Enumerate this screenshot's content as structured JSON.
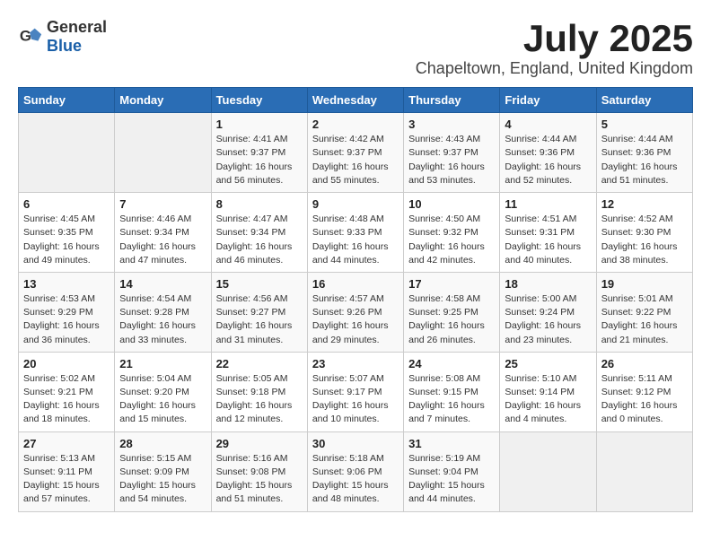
{
  "header": {
    "logo_general": "General",
    "logo_blue": "Blue",
    "month_title": "July 2025",
    "location": "Chapeltown, England, United Kingdom"
  },
  "days_of_week": [
    "Sunday",
    "Monday",
    "Tuesday",
    "Wednesday",
    "Thursday",
    "Friday",
    "Saturday"
  ],
  "weeks": [
    [
      {
        "day": "",
        "sunrise": "",
        "sunset": "",
        "daylight": ""
      },
      {
        "day": "",
        "sunrise": "",
        "sunset": "",
        "daylight": ""
      },
      {
        "day": "1",
        "sunrise": "Sunrise: 4:41 AM",
        "sunset": "Sunset: 9:37 PM",
        "daylight": "Daylight: 16 hours and 56 minutes."
      },
      {
        "day": "2",
        "sunrise": "Sunrise: 4:42 AM",
        "sunset": "Sunset: 9:37 PM",
        "daylight": "Daylight: 16 hours and 55 minutes."
      },
      {
        "day": "3",
        "sunrise": "Sunrise: 4:43 AM",
        "sunset": "Sunset: 9:37 PM",
        "daylight": "Daylight: 16 hours and 53 minutes."
      },
      {
        "day": "4",
        "sunrise": "Sunrise: 4:44 AM",
        "sunset": "Sunset: 9:36 PM",
        "daylight": "Daylight: 16 hours and 52 minutes."
      },
      {
        "day": "5",
        "sunrise": "Sunrise: 4:44 AM",
        "sunset": "Sunset: 9:36 PM",
        "daylight": "Daylight: 16 hours and 51 minutes."
      }
    ],
    [
      {
        "day": "6",
        "sunrise": "Sunrise: 4:45 AM",
        "sunset": "Sunset: 9:35 PM",
        "daylight": "Daylight: 16 hours and 49 minutes."
      },
      {
        "day": "7",
        "sunrise": "Sunrise: 4:46 AM",
        "sunset": "Sunset: 9:34 PM",
        "daylight": "Daylight: 16 hours and 47 minutes."
      },
      {
        "day": "8",
        "sunrise": "Sunrise: 4:47 AM",
        "sunset": "Sunset: 9:34 PM",
        "daylight": "Daylight: 16 hours and 46 minutes."
      },
      {
        "day": "9",
        "sunrise": "Sunrise: 4:48 AM",
        "sunset": "Sunset: 9:33 PM",
        "daylight": "Daylight: 16 hours and 44 minutes."
      },
      {
        "day": "10",
        "sunrise": "Sunrise: 4:50 AM",
        "sunset": "Sunset: 9:32 PM",
        "daylight": "Daylight: 16 hours and 42 minutes."
      },
      {
        "day": "11",
        "sunrise": "Sunrise: 4:51 AM",
        "sunset": "Sunset: 9:31 PM",
        "daylight": "Daylight: 16 hours and 40 minutes."
      },
      {
        "day": "12",
        "sunrise": "Sunrise: 4:52 AM",
        "sunset": "Sunset: 9:30 PM",
        "daylight": "Daylight: 16 hours and 38 minutes."
      }
    ],
    [
      {
        "day": "13",
        "sunrise": "Sunrise: 4:53 AM",
        "sunset": "Sunset: 9:29 PM",
        "daylight": "Daylight: 16 hours and 36 minutes."
      },
      {
        "day": "14",
        "sunrise": "Sunrise: 4:54 AM",
        "sunset": "Sunset: 9:28 PM",
        "daylight": "Daylight: 16 hours and 33 minutes."
      },
      {
        "day": "15",
        "sunrise": "Sunrise: 4:56 AM",
        "sunset": "Sunset: 9:27 PM",
        "daylight": "Daylight: 16 hours and 31 minutes."
      },
      {
        "day": "16",
        "sunrise": "Sunrise: 4:57 AM",
        "sunset": "Sunset: 9:26 PM",
        "daylight": "Daylight: 16 hours and 29 minutes."
      },
      {
        "day": "17",
        "sunrise": "Sunrise: 4:58 AM",
        "sunset": "Sunset: 9:25 PM",
        "daylight": "Daylight: 16 hours and 26 minutes."
      },
      {
        "day": "18",
        "sunrise": "Sunrise: 5:00 AM",
        "sunset": "Sunset: 9:24 PM",
        "daylight": "Daylight: 16 hours and 23 minutes."
      },
      {
        "day": "19",
        "sunrise": "Sunrise: 5:01 AM",
        "sunset": "Sunset: 9:22 PM",
        "daylight": "Daylight: 16 hours and 21 minutes."
      }
    ],
    [
      {
        "day": "20",
        "sunrise": "Sunrise: 5:02 AM",
        "sunset": "Sunset: 9:21 PM",
        "daylight": "Daylight: 16 hours and 18 minutes."
      },
      {
        "day": "21",
        "sunrise": "Sunrise: 5:04 AM",
        "sunset": "Sunset: 9:20 PM",
        "daylight": "Daylight: 16 hours and 15 minutes."
      },
      {
        "day": "22",
        "sunrise": "Sunrise: 5:05 AM",
        "sunset": "Sunset: 9:18 PM",
        "daylight": "Daylight: 16 hours and 12 minutes."
      },
      {
        "day": "23",
        "sunrise": "Sunrise: 5:07 AM",
        "sunset": "Sunset: 9:17 PM",
        "daylight": "Daylight: 16 hours and 10 minutes."
      },
      {
        "day": "24",
        "sunrise": "Sunrise: 5:08 AM",
        "sunset": "Sunset: 9:15 PM",
        "daylight": "Daylight: 16 hours and 7 minutes."
      },
      {
        "day": "25",
        "sunrise": "Sunrise: 5:10 AM",
        "sunset": "Sunset: 9:14 PM",
        "daylight": "Daylight: 16 hours and 4 minutes."
      },
      {
        "day": "26",
        "sunrise": "Sunrise: 5:11 AM",
        "sunset": "Sunset: 9:12 PM",
        "daylight": "Daylight: 16 hours and 0 minutes."
      }
    ],
    [
      {
        "day": "27",
        "sunrise": "Sunrise: 5:13 AM",
        "sunset": "Sunset: 9:11 PM",
        "daylight": "Daylight: 15 hours and 57 minutes."
      },
      {
        "day": "28",
        "sunrise": "Sunrise: 5:15 AM",
        "sunset": "Sunset: 9:09 PM",
        "daylight": "Daylight: 15 hours and 54 minutes."
      },
      {
        "day": "29",
        "sunrise": "Sunrise: 5:16 AM",
        "sunset": "Sunset: 9:08 PM",
        "daylight": "Daylight: 15 hours and 51 minutes."
      },
      {
        "day": "30",
        "sunrise": "Sunrise: 5:18 AM",
        "sunset": "Sunset: 9:06 PM",
        "daylight": "Daylight: 15 hours and 48 minutes."
      },
      {
        "day": "31",
        "sunrise": "Sunrise: 5:19 AM",
        "sunset": "Sunset: 9:04 PM",
        "daylight": "Daylight: 15 hours and 44 minutes."
      },
      {
        "day": "",
        "sunrise": "",
        "sunset": "",
        "daylight": ""
      },
      {
        "day": "",
        "sunrise": "",
        "sunset": "",
        "daylight": ""
      }
    ]
  ]
}
